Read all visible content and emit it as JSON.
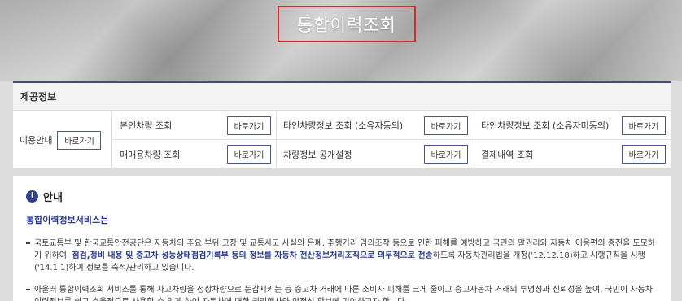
{
  "page": {
    "title": "통합이력조회"
  },
  "services": {
    "heading": "제공정보",
    "usage": {
      "label": "이용안내",
      "button": "바로가기"
    },
    "items": [
      {
        "label": "본인차량 조회",
        "button": "바로가기"
      },
      {
        "label": "타인차량정보 조회 (소유자동의)",
        "button": "바로가기"
      },
      {
        "label": "타인차량정보 조회 (소유자미동의)",
        "button": "바로가기"
      },
      {
        "label": "매매용차량 조회",
        "button": "바로가기"
      },
      {
        "label": "차량정보 공개설정",
        "button": "바로가기"
      },
      {
        "label": "결제내역 조회",
        "button": "바로가기"
      }
    ]
  },
  "notice": {
    "icon": "info-icon",
    "icon_glyph": "i",
    "title": "안내",
    "subtitle": "통합이력정보서비스는",
    "p1_a": "국토교통부 및 한국교통안전공단은 자동차의 주요 부위 고장 및 교통사고 사실의 은폐, 주행거리 임의조작 등으로 인한 피해를 예방하고 국민의 알권리와 자동차 이용편의 증진을 도모하기 위하여, ",
    "p1_em": "점검,정비 내용 및 중고차 성능상태점검기록부 등의 정보를 자동차 전산정보처리조직으로 의무적으로 전송",
    "p1_b": "하도록 자동차관리법을 개정('12.12.18)하고 시행규칙을 시행('14.1.1)하여 정보를 축적/관리하고 있습니다.",
    "p2": "아울러 통합이력조회 서비스를 통해 사고차량을 정상차량으로 둔갑시키는 등 중고차 거래에 따른 소비자 피해를 크게 줄이고 중고자동차 거래의 투명성과 신뢰성을 높여, 국민이 자동차 이력정보를 쉽고 효율적으로 사용할 수 있게 하여 자동차에 대한 권리행사와 안전성 확보에 기여하고자 합니다."
  },
  "colors": {
    "accent": "#2b3a8f",
    "highlight_border": "#d42a2a",
    "panel_border": "#3f4d7b"
  }
}
